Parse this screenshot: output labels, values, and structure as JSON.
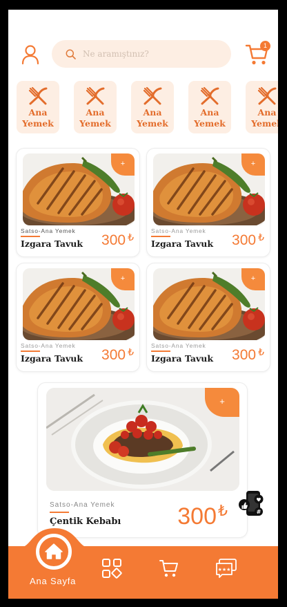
{
  "header": {
    "search_placeholder": "Ne aramıştınız?",
    "cart_count": "1"
  },
  "categories": [
    {
      "line1": "Ana",
      "line2": "Yemek"
    },
    {
      "line1": "Ana",
      "line2": "Yemek"
    },
    {
      "line1": "Ana",
      "line2": "Yemek"
    },
    {
      "line1": "Ana",
      "line2": "Yemek"
    },
    {
      "line1": "Ana",
      "line2": "Yemek"
    }
  ],
  "products": [
    {
      "category": "Satso-Ana Yemek",
      "name": "Izgara Tavuk",
      "price": "300",
      "currency": "₺",
      "add": "+"
    },
    {
      "category": "Satso-Ana Yemek",
      "name": "Izgara Tavuk",
      "price": "300",
      "currency": "₺",
      "add": "+"
    },
    {
      "category": "Satso-Ana Yemek",
      "name": "Izgara Tavuk",
      "price": "300",
      "currency": "₺",
      "add": "+"
    },
    {
      "category": "Satso-Ana Yemek",
      "name": "Izgara Tavuk",
      "price": "300",
      "currency": "₺",
      "add": "+"
    }
  ],
  "featured": {
    "category": "Satso-Ana Yemek",
    "name": "Çentik Kebabı",
    "price": "300",
    "currency": "₺",
    "add": "+"
  },
  "nav": {
    "home_label": "Ana Sayfa"
  },
  "icons": {
    "user": "user-icon",
    "search": "search-icon",
    "cart": "cart-icon",
    "category": "fork-knife-icon",
    "home": "home-icon",
    "grid": "category-grid-icon",
    "reviews": "reviews-icon",
    "chat": "chat-icon"
  },
  "colors": {
    "accent": "#f47a34",
    "soft": "#fdeee3",
    "text": "#1a1a1a"
  }
}
